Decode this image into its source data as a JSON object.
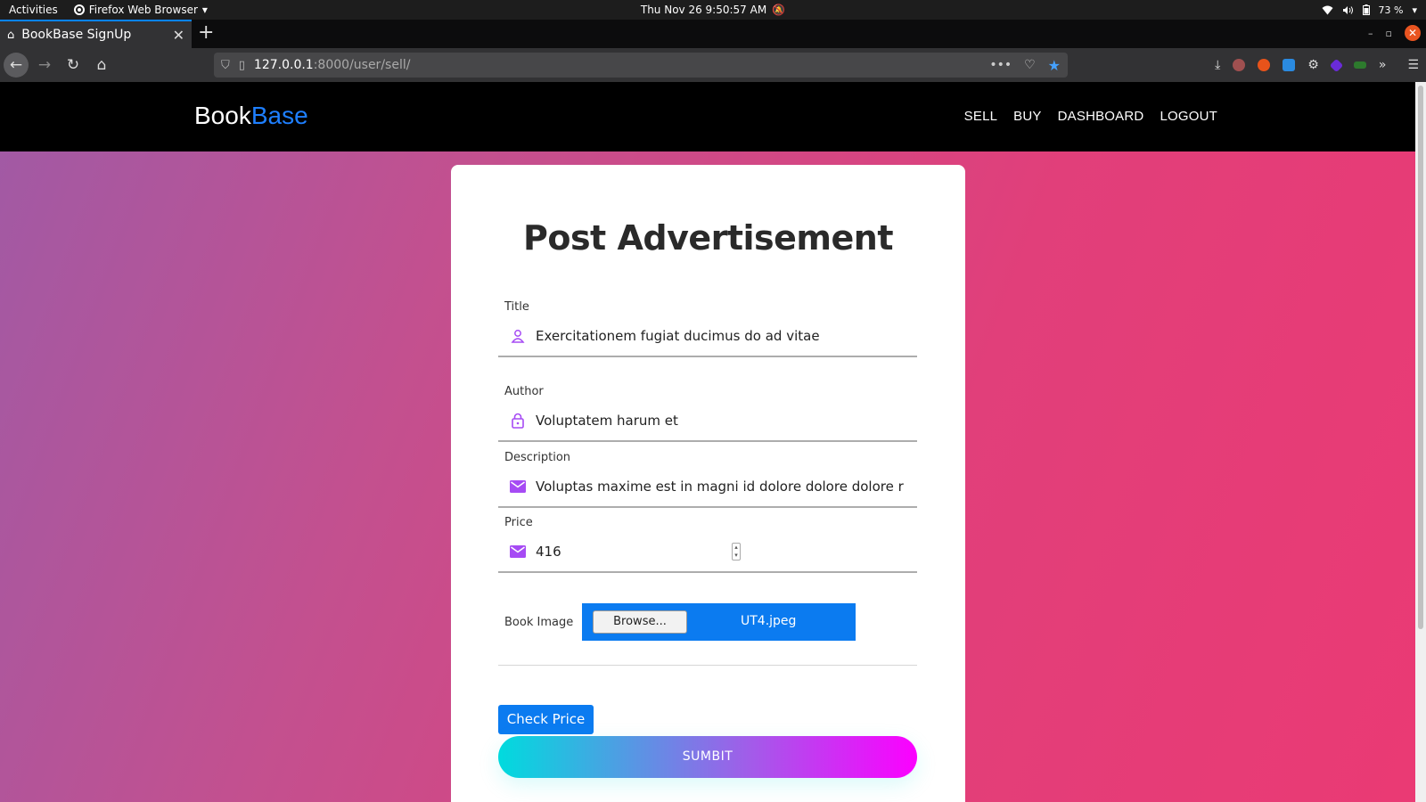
{
  "system": {
    "activities": "Activities",
    "app_menu": "Firefox Web Browser",
    "datetime": "Thu Nov 26  9:50:57 AM",
    "battery": "73 %"
  },
  "browser": {
    "tab_title": "BookBase SignUp",
    "url_host": "127.0.0.1",
    "url_rest": ":8000/user/sell/"
  },
  "site": {
    "brand_part1": "Book",
    "brand_part2": "Base",
    "nav": [
      "SELL",
      "BUY",
      "DASHBOARD",
      "LOGOUT"
    ]
  },
  "form": {
    "heading": "Post Advertisement",
    "title_label": "Title",
    "title_value": "Exercitationem fugiat ducimus do ad vitae",
    "author_label": "Author",
    "author_value": "Voluptatem harum et",
    "description_label": "Description",
    "description_value": "Voluptas maxime est in magni id dolore dolore dolore r",
    "price_label": "Price",
    "price_value": "416",
    "image_label": "Book Image",
    "browse_label": "Browse...",
    "file_name": "UT4.jpeg",
    "check_price_label": "Check Price",
    "submit_label": "SUMBIT"
  },
  "colors": {
    "accent": "#0b7bf0",
    "icon": "#a64bf4",
    "brand_blue": "#1e7fff"
  }
}
